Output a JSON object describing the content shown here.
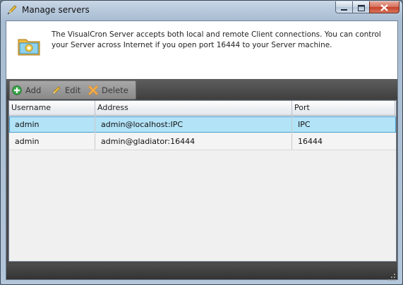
{
  "window": {
    "title": "Manage servers",
    "icon": "pencil-icon"
  },
  "info": {
    "icon": "server-folder-icon",
    "text": "The VisualCron Server accepts both local and remote Client connections. You can control your Server across Internet if you open port 16444 to your Server machine."
  },
  "toolbar": {
    "add_label": "Add",
    "edit_label": "Edit",
    "delete_label": "Delete"
  },
  "grid": {
    "columns": [
      "Username",
      "Address",
      "Port"
    ],
    "rows": [
      {
        "username": "admin",
        "address": "admin@localhost:IPC",
        "port": "IPC",
        "selected": true
      },
      {
        "username": "admin",
        "address": "admin@gladiator:16444",
        "port": "16444",
        "selected": false
      }
    ]
  },
  "colors": {
    "selection": "#b3e3f7",
    "toolbar_dark": "#4a4a4a",
    "close_button": "#c4402a"
  }
}
